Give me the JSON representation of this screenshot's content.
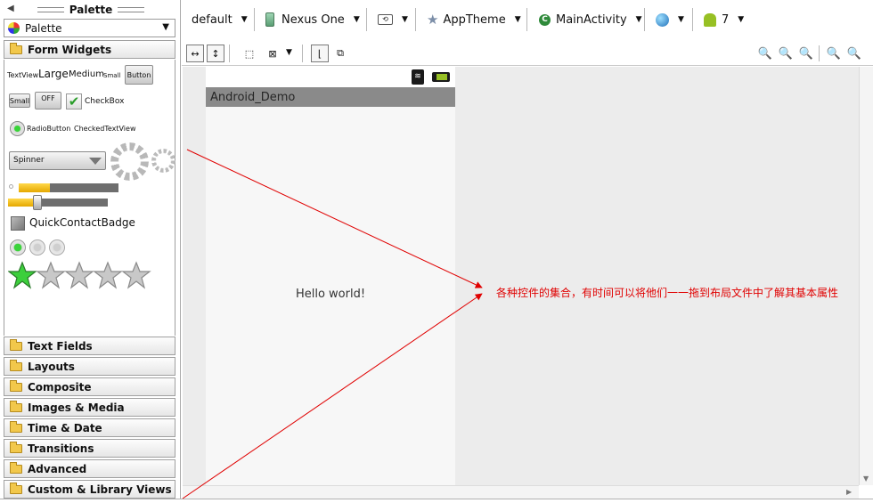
{
  "palette": {
    "title": "Palette",
    "mode_label": "Palette",
    "open_category": "Form Widgets",
    "widgets": {
      "textview": "TextView",
      "large": "Large",
      "medium": "Medium",
      "small": "Small",
      "button": "Button",
      "small_button": "Small",
      "toggle": "OFF",
      "checkbox": "CheckBox",
      "radiobutton": "RadioButton",
      "checkedtextview": "CheckedTextView",
      "spinner": "Spinner",
      "quickcontact": "QuickContactBadge"
    },
    "categories": [
      "Text Fields",
      "Layouts",
      "Composite",
      "Images & Media",
      "Time & Date",
      "Transitions",
      "Advanced",
      "Custom & Library Views"
    ]
  },
  "toolbar": {
    "config": "default",
    "device": "Nexus One",
    "theme": "AppTheme",
    "activity": "MainActivity",
    "api_level": "7"
  },
  "preview": {
    "app_title": "Android_Demo",
    "hello_text": "Hello world!"
  },
  "annotation": "各种控件的集合，有时间可以将他们一一拖到布局文件中了解其基本属性",
  "colors": {
    "accent": "#e00000",
    "actionbar": "#8a8a8a",
    "android_green": "#97c024"
  }
}
